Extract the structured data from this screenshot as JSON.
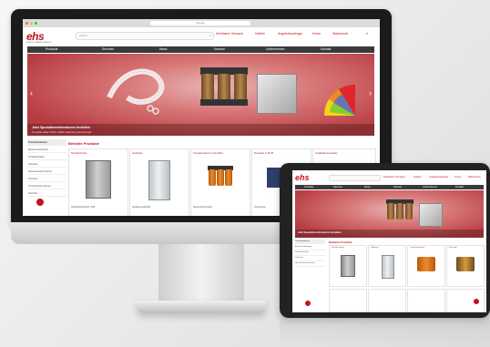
{
  "brand": {
    "logo": "ehs",
    "tagline": "ELEKTRO-HANDEL-SERVICE",
    "accent": "#c3141c"
  },
  "browser": {
    "url": "ehs.de"
  },
  "header": {
    "links": [
      "Drehbarer Versand",
      "Hotline",
      "Angebotsanfrage",
      "Konto",
      "Warenkorb"
    ],
    "search_placeholder": "Suche"
  },
  "nav": [
    "Produkte",
    "Services",
    "News",
    "Karriere",
    "Unternehmen",
    "Kontakt"
  ],
  "hero": {
    "title": "Jetzt Spezialtransformatoren bestellen",
    "subtitle": "Zu guten alten Preis. Dank Lieferung aus Europa"
  },
  "sidebar": [
    "Transformatoren",
    "Elektroverteilungen",
    "Schaltschränke",
    "Gehäuse",
    "Steuertransformatoren",
    "Drosseln",
    "Trenntransformatoren",
    "Netzteile"
  ],
  "main": {
    "section_title": "Beliebte Produkte",
    "cards": [
      {
        "title": "Schaltschrank",
        "text": "Schaltschrank RAL 7035"
      },
      {
        "title": "Gehäuse",
        "text": "Gehäuse Edelstahl"
      },
      {
        "title": "Transformatoren drei Wick.",
        "text": "Steuertransformator"
      },
      {
        "title": "Drosseln in Profil",
        "text": "Netzdrossel"
      },
      {
        "title": "Installationsverteiler",
        "text": "Installationsverteiler"
      }
    ]
  },
  "ipad": {
    "nav": [
      "Produkte",
      "Services",
      "News",
      "Karriere",
      "Unternehmen",
      "Kontakt"
    ],
    "hero_title": "Jetzt Spezialtransformatoren bestellen",
    "section_title": "Beliebte Produkte",
    "cards": [
      "Schaltschrank",
      "Gehäuse",
      "Transformatoren",
      "Drosseln"
    ]
  }
}
